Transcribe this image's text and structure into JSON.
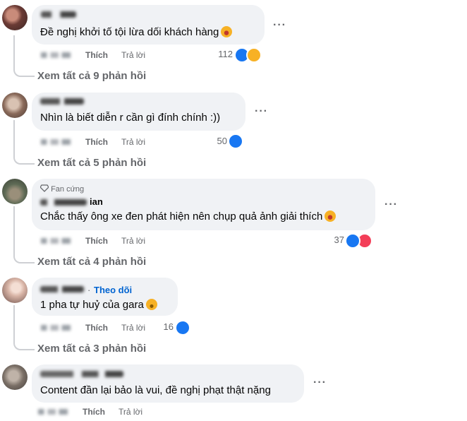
{
  "comments": [
    {
      "text": "Đề nghị khởi tố tội lừa dối khách hàng",
      "emoji": "laughing-emoji",
      "like_label": "Thích",
      "reply_label": "Trả lời",
      "reaction_count": "112",
      "reactions": [
        "like",
        "haha"
      ],
      "see_all": "Xem tất cả 9 phản hồi"
    },
    {
      "text": "Nhìn là biết diễn r cần gì đính chính :))",
      "like_label": "Thích",
      "reply_label": "Trả lời",
      "reaction_count": "50",
      "reactions": [
        "like"
      ],
      "see_all": "Xem tất cả 5 phản hồi"
    },
    {
      "badge": "Fan cứng",
      "name_suffix": "ian",
      "text": "Chắc thấy ông xe đen phát hiện nên chụp quả ảnh giải thích",
      "emoji": "laughing-emoji",
      "like_label": "Thích",
      "reply_label": "Trả lời",
      "reaction_count": "37",
      "reactions": [
        "like",
        "heart"
      ],
      "see_all": "Xem tất cả 4 phản hồi"
    },
    {
      "follow_label": "Theo dõi",
      "text": "1 pha tự huỷ của gara",
      "emoji": "smiling-emoji",
      "like_label": "Thích",
      "reply_label": "Trả lời",
      "reaction_count": "16",
      "reactions": [
        "like"
      ],
      "see_all": "Xem tất cả 3 phản hồi"
    },
    {
      "text": "Content đần lại bảo là vui, đề nghị phạt thật nặng",
      "like_label": "Thích",
      "reply_label": "Trả lời"
    }
  ],
  "more_glyph": "···",
  "colors": {
    "like": "#1877f2",
    "heart": "#f33e58",
    "haha": "#f7b125",
    "follow": "#0064d1",
    "muted": "#65676b",
    "bubble": "#f0f2f5"
  }
}
